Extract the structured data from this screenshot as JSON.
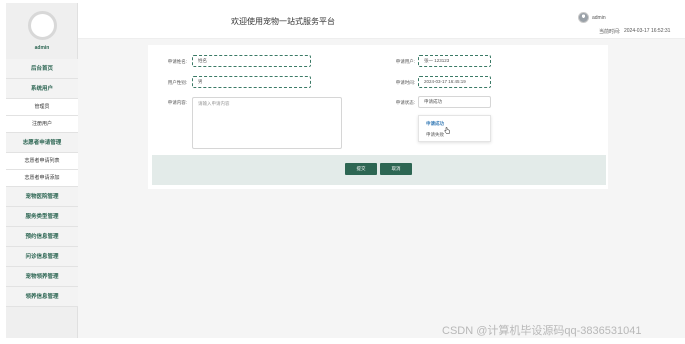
{
  "sidebar": {
    "username": "admin",
    "items": [
      {
        "label": "后台首页",
        "sub": false
      },
      {
        "label": "系统用户",
        "sub": false
      },
      {
        "label": "管理员",
        "sub": true
      },
      {
        "label": "注册用户",
        "sub": true
      },
      {
        "label": "志愿者申请管理",
        "sub": false
      },
      {
        "label": "志愿者申请列表",
        "sub": true
      },
      {
        "label": "志愿者申请添加",
        "sub": true
      },
      {
        "label": "宠物医院管理",
        "sub": false
      },
      {
        "label": "服务类型管理",
        "sub": false
      },
      {
        "label": "预约信息管理",
        "sub": false
      },
      {
        "label": "问诊信息管理",
        "sub": false
      },
      {
        "label": "宠物领养管理",
        "sub": false
      },
      {
        "label": "领养信息管理",
        "sub": false
      }
    ]
  },
  "header": {
    "title": "欢迎使用宠物一站式服务平台",
    "username": "admin",
    "time_label": "当前时间:",
    "time_value": "2024-03-17 16:52:31"
  },
  "form": {
    "name_label": "申请姓名:",
    "name_value": "姓名",
    "gender_label": "用户性别:",
    "gender_value": "男",
    "address_label": "申请内容:",
    "address_placeholder": "请输入申请内容",
    "account_label": "申请用户:",
    "account_value": "张一 123123",
    "date_label": "申请时间:",
    "date_value": "2024-03-17 16:45:19",
    "status_label": "申请状态:",
    "status_value": "申请成功",
    "status_options": [
      "申请成功",
      "申请失败"
    ]
  },
  "buttons": {
    "submit": "提交",
    "cancel": "取消"
  },
  "watermark": "CSDN @计算机毕设源码qq-3836531041"
}
